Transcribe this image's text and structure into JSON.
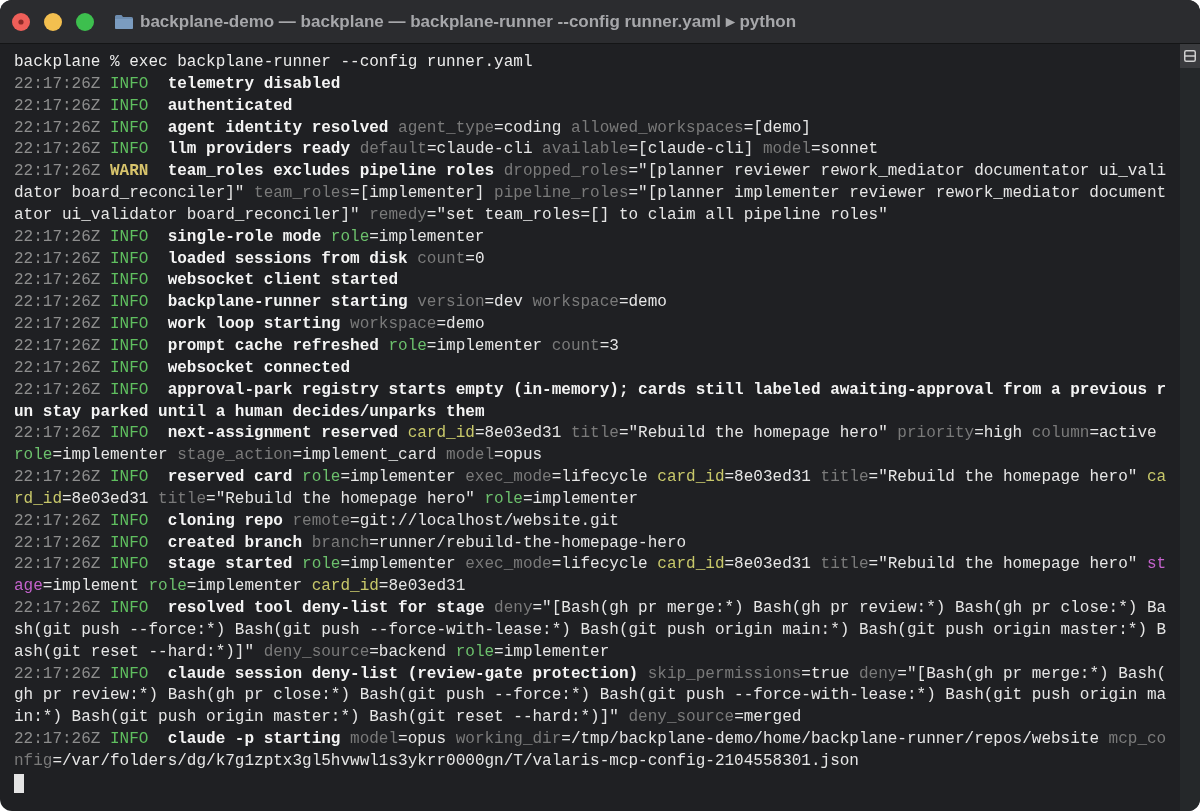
{
  "window": {
    "title": "backplane-demo — backplane — backplane-runner --config runner.yaml ▸ python"
  },
  "terminal": {
    "lines": [
      {
        "segments": [
          {
            "kind": "command",
            "text": "backplane % exec backplane-runner --config runner.yaml"
          }
        ]
      },
      {
        "segments": [
          {
            "kind": "time",
            "text": "22:17:26Z"
          },
          {
            "kind": "info",
            "text": "INFO"
          },
          {
            "kind": "message",
            "text": "telemetry disabled"
          }
        ]
      },
      {
        "segments": [
          {
            "kind": "time",
            "text": "22:17:26Z"
          },
          {
            "kind": "info",
            "text": "INFO"
          },
          {
            "kind": "message",
            "text": "authenticated"
          }
        ]
      },
      {
        "segments": [
          {
            "kind": "time",
            "text": "22:17:26Z"
          },
          {
            "kind": "info",
            "text": "INFO"
          },
          {
            "kind": "message",
            "text": "agent identity resolved"
          },
          {
            "kind": "key",
            "text": "agent_type",
            "color": "#7a7a7a"
          },
          {
            "kind": "value",
            "text": "=coding"
          },
          {
            "kind": "key",
            "text": "allowed_workspaces",
            "color": "#7a7a7a"
          },
          {
            "kind": "value",
            "text": "=[demo]"
          }
        ]
      },
      {
        "segments": [
          {
            "kind": "time",
            "text": "22:17:26Z"
          },
          {
            "kind": "info",
            "text": "INFO"
          },
          {
            "kind": "message",
            "text": "llm providers ready"
          },
          {
            "kind": "key",
            "text": "default",
            "color": "#7a7a7a"
          },
          {
            "kind": "value",
            "text": "=claude-cli"
          },
          {
            "kind": "key",
            "text": "available",
            "color": "#7a7a7a"
          },
          {
            "kind": "value",
            "text": "=[claude-cli]"
          },
          {
            "kind": "key",
            "text": "model",
            "color": "#7a7a7a"
          },
          {
            "kind": "value",
            "text": "=sonnet"
          }
        ]
      },
      {
        "segments": [
          {
            "kind": "time",
            "text": "22:17:26Z"
          },
          {
            "kind": "warn",
            "text": "WARN"
          },
          {
            "kind": "message",
            "text": "team_roles excludes pipeline roles"
          },
          {
            "kind": "key",
            "text": "dropped_roles",
            "color": "#7a7a7a"
          },
          {
            "kind": "value",
            "text": "=\"[planner reviewer rework_mediator documentator ui_vali"
          }
        ]
      },
      {
        "segments": [
          {
            "kind": "value",
            "text": "dator board_reconciler]\""
          },
          {
            "kind": "key",
            "text": "team_roles",
            "color": "#7a7a7a"
          },
          {
            "kind": "value",
            "text": "=[implementer]"
          },
          {
            "kind": "key",
            "text": "pipeline_roles",
            "color": "#7a7a7a"
          },
          {
            "kind": "value",
            "text": "=\"[planner implementer reviewer rework_mediator document"
          }
        ]
      },
      {
        "segments": [
          {
            "kind": "value",
            "text": "ator ui_validator board_reconciler]\""
          },
          {
            "kind": "key",
            "text": "remedy",
            "color": "#7a7a7a"
          },
          {
            "kind": "value",
            "text": "=\"set team_roles=[] to claim all pipeline roles\""
          }
        ]
      },
      {
        "segments": [
          {
            "kind": "time",
            "text": "22:17:26Z"
          },
          {
            "kind": "info",
            "text": "INFO"
          },
          {
            "kind": "message",
            "text": "single-role mode"
          },
          {
            "kind": "key",
            "text": "role",
            "color": "#6cc06c"
          },
          {
            "kind": "value",
            "text": "=implementer"
          }
        ]
      },
      {
        "segments": [
          {
            "kind": "time",
            "text": "22:17:26Z"
          },
          {
            "kind": "info",
            "text": "INFO"
          },
          {
            "kind": "message",
            "text": "loaded sessions from disk"
          },
          {
            "kind": "key",
            "text": "count",
            "color": "#7a7a7a"
          },
          {
            "kind": "value",
            "text": "=0"
          }
        ]
      },
      {
        "segments": [
          {
            "kind": "time",
            "text": "22:17:26Z"
          },
          {
            "kind": "info",
            "text": "INFO"
          },
          {
            "kind": "message",
            "text": "websocket client started"
          }
        ]
      },
      {
        "segments": [
          {
            "kind": "time",
            "text": "22:17:26Z"
          },
          {
            "kind": "info",
            "text": "INFO"
          },
          {
            "kind": "message",
            "text": "backplane-runner starting"
          },
          {
            "kind": "key",
            "text": "version",
            "color": "#7a7a7a"
          },
          {
            "kind": "value",
            "text": "=dev"
          },
          {
            "kind": "key",
            "text": "workspace",
            "color": "#7a7a7a"
          },
          {
            "kind": "value",
            "text": "=demo"
          }
        ]
      },
      {
        "segments": [
          {
            "kind": "time",
            "text": "22:17:26Z"
          },
          {
            "kind": "info",
            "text": "INFO"
          },
          {
            "kind": "message",
            "text": "work loop starting"
          },
          {
            "kind": "key",
            "text": "workspace",
            "color": "#7a7a7a"
          },
          {
            "kind": "value",
            "text": "=demo"
          }
        ]
      },
      {
        "segments": [
          {
            "kind": "time",
            "text": "22:17:26Z"
          },
          {
            "kind": "info",
            "text": "INFO"
          },
          {
            "kind": "message",
            "text": "prompt cache refreshed"
          },
          {
            "kind": "key",
            "text": "role",
            "color": "#6cc06c"
          },
          {
            "kind": "value",
            "text": "=implementer"
          },
          {
            "kind": "key",
            "text": "count",
            "color": "#7a7a7a"
          },
          {
            "kind": "value",
            "text": "=3"
          }
        ]
      },
      {
        "segments": [
          {
            "kind": "time",
            "text": "22:17:26Z"
          },
          {
            "kind": "info",
            "text": "INFO"
          },
          {
            "kind": "message",
            "text": "websocket connected"
          }
        ]
      },
      {
        "segments": [
          {
            "kind": "time",
            "text": "22:17:26Z"
          },
          {
            "kind": "info",
            "text": "INFO"
          },
          {
            "kind": "message",
            "text": "approval-park registry starts empty (in-memory); cards still labeled awaiting-approval from a previous r"
          }
        ]
      },
      {
        "segments": [
          {
            "kind": "message",
            "text": "un stay parked until a human decides/unparks them"
          }
        ]
      },
      {
        "segments": [
          {
            "kind": "time",
            "text": "22:17:26Z"
          },
          {
            "kind": "info",
            "text": "INFO"
          },
          {
            "kind": "message",
            "text": "next-assignment reserved"
          },
          {
            "kind": "key",
            "text": "card_id",
            "color": "#c8c86a"
          },
          {
            "kind": "value",
            "text": "=8e03ed31"
          },
          {
            "kind": "key",
            "text": "title",
            "color": "#7a7a7a"
          },
          {
            "kind": "value",
            "text": "=\"Rebuild the homepage hero\""
          },
          {
            "kind": "key",
            "text": "priority",
            "color": "#7a7a7a"
          },
          {
            "kind": "value",
            "text": "=high"
          },
          {
            "kind": "key",
            "text": "column",
            "color": "#7a7a7a"
          },
          {
            "kind": "value",
            "text": "=active"
          }
        ]
      },
      {
        "segments": [
          {
            "kind": "key",
            "text": "role",
            "color": "#6cc06c"
          },
          {
            "kind": "value",
            "text": "=implementer"
          },
          {
            "kind": "key",
            "text": "stage_action",
            "color": "#7a7a7a"
          },
          {
            "kind": "value",
            "text": "=implement_card"
          },
          {
            "kind": "key",
            "text": "model",
            "color": "#7a7a7a"
          },
          {
            "kind": "value",
            "text": "=opus"
          }
        ]
      },
      {
        "segments": [
          {
            "kind": "time",
            "text": "22:17:26Z"
          },
          {
            "kind": "info",
            "text": "INFO"
          },
          {
            "kind": "message",
            "text": "reserved card"
          },
          {
            "kind": "key",
            "text": "role",
            "color": "#6cc06c"
          },
          {
            "kind": "value",
            "text": "=implementer"
          },
          {
            "kind": "key",
            "text": "exec_mode",
            "color": "#7a7a7a"
          },
          {
            "kind": "value",
            "text": "=lifecycle"
          },
          {
            "kind": "key",
            "text": "card_id",
            "color": "#c8c86a"
          },
          {
            "kind": "value",
            "text": "=8e03ed31"
          },
          {
            "kind": "key",
            "text": "title",
            "color": "#7a7a7a"
          },
          {
            "kind": "value",
            "text": "=\"Rebuild the homepage hero\""
          },
          {
            "kind": "key",
            "text": "ca",
            "color": "#c8c86a"
          }
        ]
      },
      {
        "segments": [
          {
            "kind": "key",
            "text": "rd_id",
            "color": "#c8c86a"
          },
          {
            "kind": "value",
            "text": "=8e03ed31"
          },
          {
            "kind": "key",
            "text": "title",
            "color": "#7a7a7a"
          },
          {
            "kind": "value",
            "text": "=\"Rebuild the homepage hero\""
          },
          {
            "kind": "key",
            "text": "role",
            "color": "#6cc06c"
          },
          {
            "kind": "value",
            "text": "=implementer"
          }
        ]
      },
      {
        "segments": [
          {
            "kind": "time",
            "text": "22:17:26Z"
          },
          {
            "kind": "info",
            "text": "INFO"
          },
          {
            "kind": "message",
            "text": "cloning repo"
          },
          {
            "kind": "key",
            "text": "remote",
            "color": "#7a7a7a"
          },
          {
            "kind": "value",
            "text": "=git://localhost/website.git"
          }
        ]
      },
      {
        "segments": [
          {
            "kind": "time",
            "text": "22:17:26Z"
          },
          {
            "kind": "info",
            "text": "INFO"
          },
          {
            "kind": "message",
            "text": "created branch"
          },
          {
            "kind": "key",
            "text": "branch",
            "color": "#7a7a7a"
          },
          {
            "kind": "value",
            "text": "=runner/rebuild-the-homepage-hero"
          }
        ]
      },
      {
        "segments": [
          {
            "kind": "time",
            "text": "22:17:26Z"
          },
          {
            "kind": "info",
            "text": "INFO"
          },
          {
            "kind": "message",
            "text": "stage started"
          },
          {
            "kind": "key",
            "text": "role",
            "color": "#6cc06c"
          },
          {
            "kind": "value",
            "text": "=implementer"
          },
          {
            "kind": "key",
            "text": "exec_mode",
            "color": "#7a7a7a"
          },
          {
            "kind": "value",
            "text": "=lifecycle"
          },
          {
            "kind": "key",
            "text": "card_id",
            "color": "#c8c86a"
          },
          {
            "kind": "value",
            "text": "=8e03ed31"
          },
          {
            "kind": "key",
            "text": "title",
            "color": "#7a7a7a"
          },
          {
            "kind": "value",
            "text": "=\"Rebuild the homepage hero\""
          },
          {
            "kind": "key",
            "text": "st",
            "color": "#c462cc"
          }
        ]
      },
      {
        "segments": [
          {
            "kind": "key",
            "text": "age",
            "color": "#c462cc"
          },
          {
            "kind": "value",
            "text": "=implement"
          },
          {
            "kind": "key",
            "text": "role",
            "color": "#6cc06c"
          },
          {
            "kind": "value",
            "text": "=implementer"
          },
          {
            "kind": "key",
            "text": "card_id",
            "color": "#c8c86a"
          },
          {
            "kind": "value",
            "text": "=8e03ed31"
          }
        ]
      },
      {
        "segments": [
          {
            "kind": "time",
            "text": "22:17:26Z"
          },
          {
            "kind": "info",
            "text": "INFO"
          },
          {
            "kind": "message",
            "text": "resolved tool deny-list for stage"
          },
          {
            "kind": "key",
            "text": "deny",
            "color": "#7a7a7a"
          },
          {
            "kind": "value",
            "text": "=\"[Bash(gh pr merge:*) Bash(gh pr review:*) Bash(gh pr close:*) Ba"
          }
        ]
      },
      {
        "segments": [
          {
            "kind": "value",
            "text": "sh(git push --force:*) Bash(git push --force-with-lease:*) Bash(git push origin main:*) Bash(git push origin master:*) B"
          }
        ]
      },
      {
        "segments": [
          {
            "kind": "value",
            "text": "ash(git reset --hard:*)]\""
          },
          {
            "kind": "key",
            "text": "deny_source",
            "color": "#7a7a7a"
          },
          {
            "kind": "value",
            "text": "=backend"
          },
          {
            "kind": "key",
            "text": "role",
            "color": "#6cc06c"
          },
          {
            "kind": "value",
            "text": "=implementer"
          }
        ]
      },
      {
        "segments": [
          {
            "kind": "time",
            "text": "22:17:26Z"
          },
          {
            "kind": "info",
            "text": "INFO"
          },
          {
            "kind": "message",
            "text": "claude session deny-list (review-gate protection)"
          },
          {
            "kind": "key",
            "text": "skip_permissions",
            "color": "#7a7a7a"
          },
          {
            "kind": "value",
            "text": "=true"
          },
          {
            "kind": "key",
            "text": "deny",
            "color": "#7a7a7a"
          },
          {
            "kind": "value",
            "text": "=\"[Bash(gh pr merge:*) Bash("
          }
        ]
      },
      {
        "segments": [
          {
            "kind": "value",
            "text": "gh pr review:*) Bash(gh pr close:*) Bash(git push --force:*) Bash(git push --force-with-lease:*) Bash(git push origin ma"
          }
        ]
      },
      {
        "segments": [
          {
            "kind": "value",
            "text": "in:*) Bash(git push origin master:*) Bash(git reset --hard:*)]\""
          },
          {
            "kind": "key",
            "text": "deny_source",
            "color": "#7a7a7a"
          },
          {
            "kind": "value",
            "text": "=merged"
          }
        ]
      },
      {
        "segments": [
          {
            "kind": "time",
            "text": "22:17:26Z"
          },
          {
            "kind": "info",
            "text": "INFO"
          },
          {
            "kind": "message",
            "text": "claude -p starting"
          },
          {
            "kind": "key",
            "text": "model",
            "color": "#7a7a7a"
          },
          {
            "kind": "value",
            "text": "=opus"
          },
          {
            "kind": "key",
            "text": "working_dir",
            "color": "#7a7a7a"
          },
          {
            "kind": "value",
            "text": "=/tmp/backplane-demo/home/backplane-runner/repos/website"
          },
          {
            "kind": "key",
            "text": "mcp_co",
            "color": "#7a7a7a"
          }
        ]
      },
      {
        "segments": [
          {
            "kind": "key",
            "text": "nfig",
            "color": "#7a7a7a"
          },
          {
            "kind": "value",
            "text": "=/var/folders/dg/k7g1zptx3gl5hvwwl1s3ykrr0000gn/T/valaris-mcp-config-2104558301.json"
          }
        ]
      }
    ]
  }
}
